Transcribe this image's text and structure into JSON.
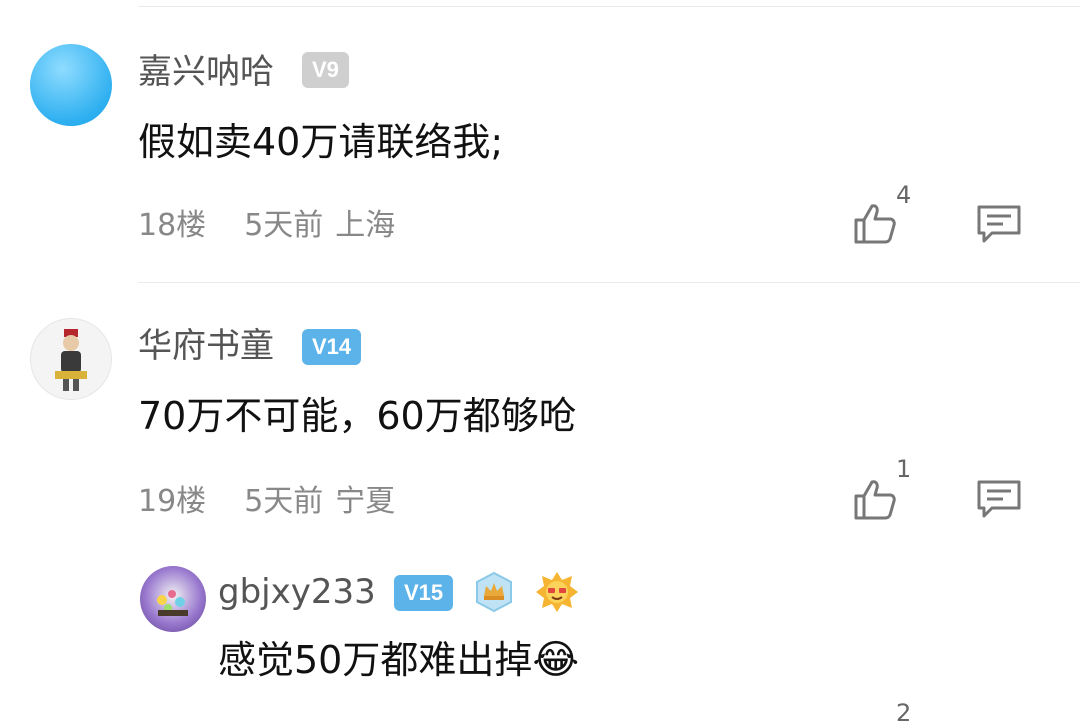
{
  "comments": [
    {
      "username": "嘉兴呐哈",
      "level": "V9",
      "text": "假如卖40万请联络我;",
      "floor": "18楼",
      "time": "5天前",
      "location": "上海",
      "likes": "4"
    },
    {
      "username": "华府书童",
      "level": "V14",
      "text": "70万不可能，60万都够呛",
      "floor": "19楼",
      "time": "5天前",
      "location": "宁夏",
      "likes": "1"
    }
  ],
  "reply": {
    "username": "gbjxy233",
    "level": "V15",
    "text": "感觉50万都难出掉",
    "emoji": "😂",
    "likes": "2"
  },
  "colors": {
    "badge_gray": "#cfcfcf",
    "badge_blue": "#5cb3ea"
  }
}
